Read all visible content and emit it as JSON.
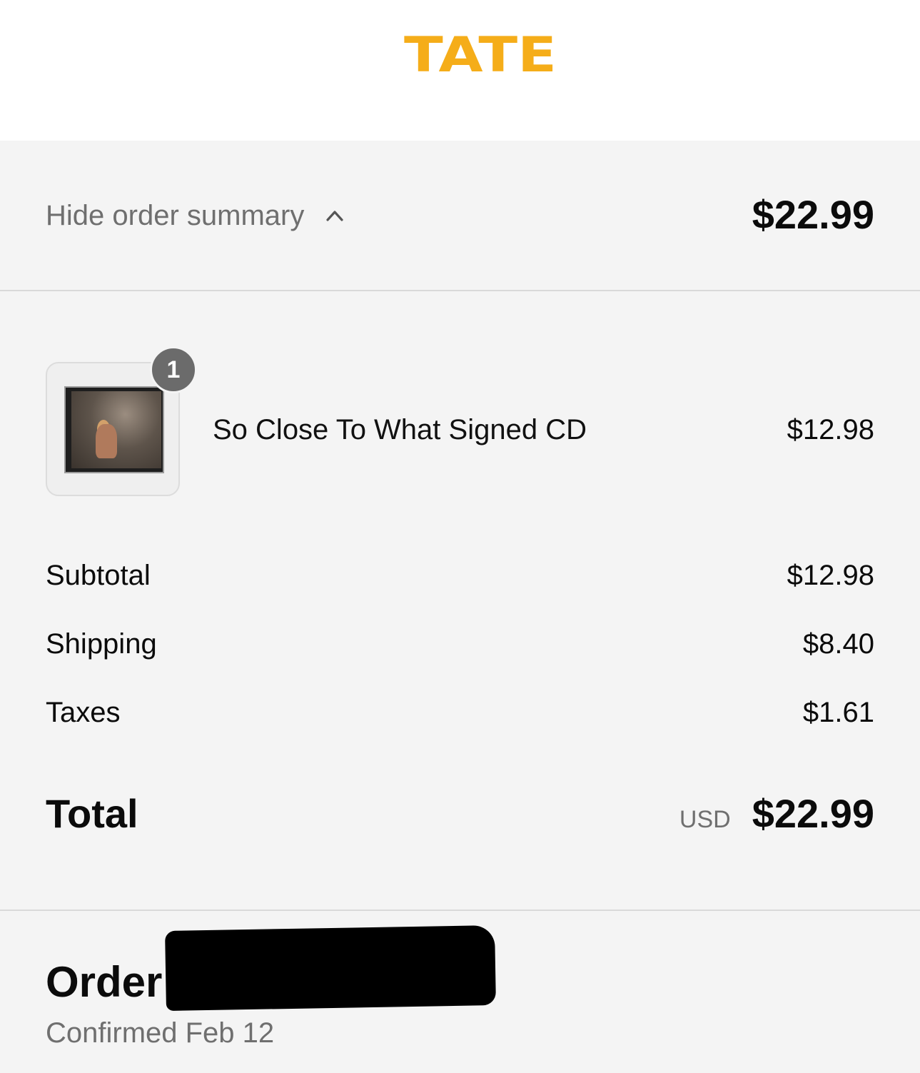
{
  "header": {
    "logo_text": "TATE",
    "logo_color": "#f5ad19"
  },
  "summary_toggle": {
    "label": "Hide order summary",
    "icon": "chevron-up-icon",
    "total": "$22.99"
  },
  "line_items": [
    {
      "quantity": "1",
      "name": "So Close To What Signed CD",
      "price": "$12.98"
    }
  ],
  "costs": {
    "subtotal_label": "Subtotal",
    "subtotal_value": "$12.98",
    "shipping_label": "Shipping",
    "shipping_value": "$8.40",
    "taxes_label": "Taxes",
    "taxes_value": "$1.61"
  },
  "total": {
    "label": "Total",
    "currency": "USD",
    "amount": "$22.99"
  },
  "order": {
    "title": "Order",
    "confirmed": "Confirmed Feb 12"
  }
}
